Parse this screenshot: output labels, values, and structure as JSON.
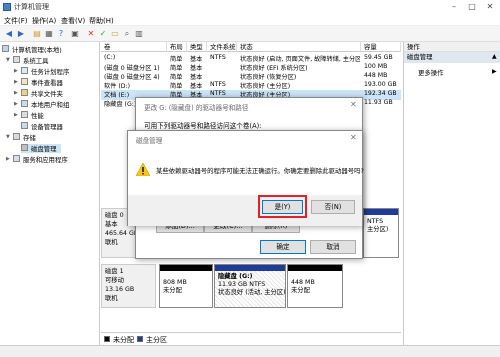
{
  "window": {
    "title": "计算机管理",
    "min": "–",
    "max": "□",
    "close": "✕"
  },
  "menu": [
    "文件(F)",
    "操作(A)",
    "查看(V)",
    "帮助(H)"
  ],
  "toolbar_icons": [
    "back-arrow-icon",
    "forward-arrow-icon",
    "up-folder-icon",
    "properties-icon",
    "help-icon",
    "delete-icon",
    "check-icon",
    "folder-icon",
    "search-icon",
    "disk-icon"
  ],
  "tree": {
    "items": [
      {
        "label": "计算机管理(本地)",
        "level": 0,
        "expanded": true,
        "icon": "computer-icon"
      },
      {
        "label": "系统工具",
        "level": 1,
        "expanded": true,
        "icon": "tools-icon"
      },
      {
        "label": "任务计划程序",
        "level": 2,
        "icon": "clock-icon"
      },
      {
        "label": "事件查看器",
        "level": 2,
        "icon": "log-icon"
      },
      {
        "label": "共享文件夹",
        "level": 2,
        "icon": "folder-icon"
      },
      {
        "label": "本地用户和组",
        "level": 2,
        "icon": "users-icon"
      },
      {
        "label": "性能",
        "level": 2,
        "icon": "chart-icon"
      },
      {
        "label": "设备管理器",
        "level": 2,
        "icon": "device-icon"
      },
      {
        "label": "存储",
        "level": 1,
        "expanded": true,
        "icon": "storage-icon"
      },
      {
        "label": "磁盘管理",
        "level": 2,
        "selected": true,
        "icon": "disk-icon"
      },
      {
        "label": "服务和应用程序",
        "level": 1,
        "icon": "services-icon"
      }
    ]
  },
  "volumes": {
    "headers": [
      "卷",
      "布局",
      "类型",
      "文件系统",
      "状态",
      "容量"
    ],
    "rows": [
      [
        "(C:)",
        "简单",
        "基本",
        "NTFS",
        "状态良好 (启动, 页面文件, 故障转储, 主分区)",
        "59.45 GB"
      ],
      [
        "(磁盘 0 磁盘分区 1)",
        "简单",
        "基本",
        "",
        "状态良好 (EFI 系统分区)",
        "100 MB"
      ],
      [
        "(磁盘 0 磁盘分区 4)",
        "简单",
        "基本",
        "",
        "状态良好 (恢复分区)",
        "448 MB"
      ],
      [
        "软件 (D:)",
        "简单",
        "基本",
        "NTFS",
        "状态良好 (主分区)",
        "193.00 GB"
      ],
      [
        "文档 (E:)",
        "简单",
        "基本",
        "NTFS",
        "状态良好 (主分区)",
        "192.34 GB"
      ],
      [
        "隐藏盘 (G:)",
        "",
        "",
        "",
        "",
        "11.93 GB"
      ]
    ]
  },
  "actions": {
    "header": "操作",
    "section": "磁盘管理",
    "more": "更多操作"
  },
  "disks": [
    {
      "name": "磁盘 0",
      "type": "基本",
      "size": "465.64 GB",
      "state": "联机"
    },
    {
      "name": "磁盘 1",
      "type": "可移动",
      "size": "13.16 GB",
      "state": "联机",
      "parts": [
        {
          "title": "",
          "size": "808 MB",
          "info": "未分配"
        },
        {
          "title": "隐藏盘 (G:)",
          "size": "11.93 GB NTFS",
          "info": "状态良好 (活动, 主分区)"
        },
        {
          "title": "",
          "size": "448 MB",
          "info": "未分配"
        }
      ]
    }
  ],
  "disk0_part_text": {
    "fs": "NTFS",
    "info": "主分区)"
  },
  "legend": [
    "未分配",
    "主分区"
  ],
  "colors": {
    "unallocated": "#000000",
    "primary": "#1f3c99",
    "selection": "#cce4f7",
    "highlight": "#e52121"
  },
  "dialog_change": {
    "title": "更改 G: (隐藏盘) 的驱动器号和路径",
    "desc": "可用下列驱动器号和路径访问这个卷(A):",
    "buttons": [
      "添加(D)...",
      "更改(C)...",
      "删除(R)"
    ],
    "ok": "确定",
    "cancel": "取消"
  },
  "dialog_confirm": {
    "title": "磁盘管理",
    "message": "某些依赖驱动器号的程序可能无法正确运行。你确定要删除此驱动器号吗?",
    "yes": "是(Y)",
    "no": "否(N)",
    "icon": "warning-icon"
  }
}
